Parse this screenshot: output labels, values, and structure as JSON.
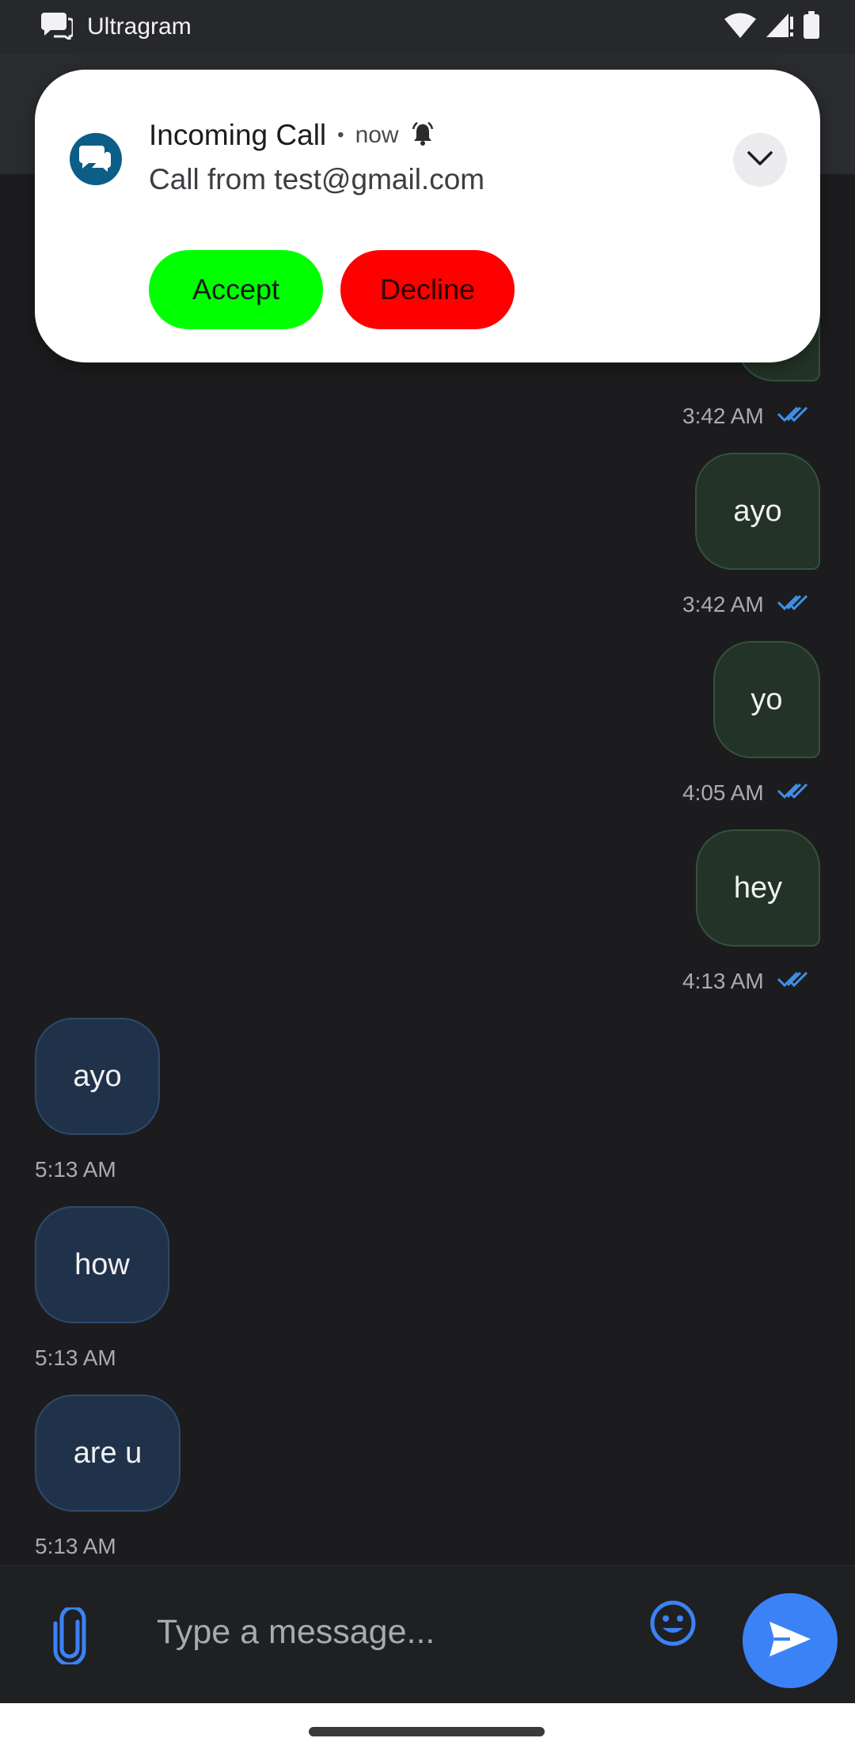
{
  "status_bar": {
    "app_name": "Ultragram",
    "app_icon": "chat-bubble-icon",
    "icons": [
      "wifi-icon",
      "signal-icon",
      "battery-icon"
    ]
  },
  "notification": {
    "title": "Incoming Call",
    "separator": "•",
    "time": "now",
    "body": "Call from test@gmail.com",
    "accept_label": "Accept",
    "decline_label": "Decline",
    "colors": {
      "accept": "#00ff00",
      "decline": "#ff0000"
    }
  },
  "messages": [
    {
      "direction": "out",
      "text": "",
      "time": "3:42 AM",
      "read": true
    },
    {
      "direction": "out",
      "text": "ayo",
      "time": "3:42 AM",
      "read": true
    },
    {
      "direction": "out",
      "text": "yo",
      "time": "4:05 AM",
      "read": true
    },
    {
      "direction": "out",
      "text": "hey",
      "time": "4:13 AM",
      "read": true
    },
    {
      "direction": "in",
      "text": "ayo",
      "time": "5:13 AM"
    },
    {
      "direction": "in",
      "text": "how",
      "time": "5:13 AM"
    },
    {
      "direction": "in",
      "text": "are u",
      "time": "5:13 AM"
    }
  ],
  "input": {
    "placeholder": "Type a message...",
    "value": ""
  },
  "colors": {
    "accent": "#3b82f6",
    "outgoing_bubble": "#233327",
    "incoming_bubble": "#1f3249"
  }
}
